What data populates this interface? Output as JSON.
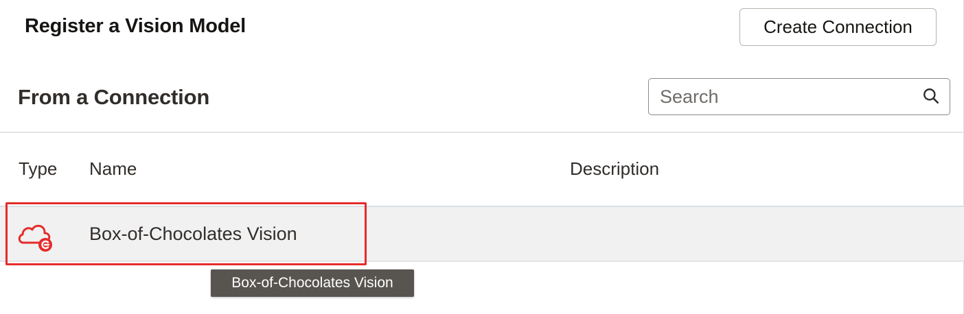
{
  "dialog": {
    "title": "Register a Vision Model",
    "create_connection_label": "Create Connection"
  },
  "section": {
    "title": "From a Connection"
  },
  "search": {
    "placeholder": "Search",
    "value": ""
  },
  "table": {
    "columns": [
      "Type",
      "Name",
      "Description"
    ],
    "rows": [
      {
        "type_icon": "cloud-connection-icon",
        "name": "Box-of-Chocolates Vision",
        "description": ""
      }
    ]
  },
  "tooltip": {
    "text": "Box-of-Chocolates Vision"
  },
  "colors": {
    "highlight": "#e52b2b",
    "icon_red": "#e52b2b",
    "row_background": "#f1f1f1",
    "tooltip_background": "#585551"
  }
}
